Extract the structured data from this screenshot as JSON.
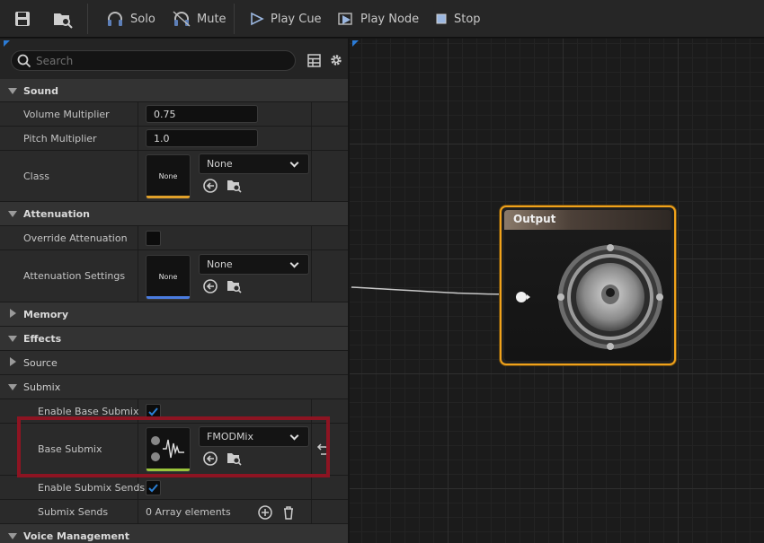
{
  "toolbar": {
    "solo": "Solo",
    "mute": "Mute",
    "play_cue": "Play Cue",
    "play_node": "Play Node",
    "stop": "Stop"
  },
  "search": {
    "placeholder": "Search"
  },
  "details": {
    "sound": {
      "header": "Sound",
      "volume_label": "Volume Multiplier",
      "volume_value": "0.75",
      "pitch_label": "Pitch Multiplier",
      "pitch_value": "1.0",
      "class_label": "Class",
      "class_thumb": "None",
      "class_value": "None"
    },
    "attenuation": {
      "header": "Attenuation",
      "override_label": "Override Attenuation",
      "override_checked": false,
      "settings_label": "Attenuation Settings",
      "settings_thumb": "None",
      "settings_value": "None"
    },
    "memory": {
      "header": "Memory"
    },
    "effects": {
      "header": "Effects",
      "source": "Source",
      "submix": "Submix",
      "enable_base_label": "Enable Base Submix",
      "enable_base_checked": true,
      "base_submix_label": "Base Submix",
      "base_submix_value": "FMODMix",
      "enable_sends_label": "Enable Submix Sends",
      "enable_sends_checked": true,
      "sends_label": "Submix Sends",
      "sends_value": "0 Array elements"
    },
    "voice_management": {
      "header": "Voice Management"
    }
  },
  "graph": {
    "output_node_title": "Output"
  },
  "colors": {
    "accent_blue": "#2b7bd6",
    "node_border": "#f0a21b",
    "highlight": "#8d1422",
    "checkbox_check": "#2a7fd4"
  }
}
